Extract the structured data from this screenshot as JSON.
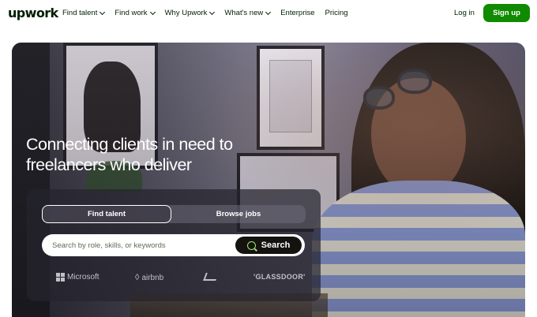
{
  "nav": {
    "logo": "upwork",
    "links": [
      "Find talent",
      "Find work",
      "Why Upwork",
      "What's new",
      "Enterprise",
      "Pricing"
    ],
    "login": "Log in",
    "signup": "Sign up"
  },
  "hero": {
    "headline_line1": "Connecting clients in need to",
    "headline_line2": "freelancers who deliver",
    "tabs": {
      "active": "Find talent",
      "inactive": "Browse jobs"
    },
    "search": {
      "placeholder": "Search by role, skills, or keywords",
      "button": "Search"
    },
    "brands": {
      "microsoft": "Microsoft",
      "airbnb": "airbnb",
      "glassdoor": "'GLASSDOOR'"
    }
  },
  "colors": {
    "accent": "#108a00",
    "search_icon": "#9ee86f"
  }
}
